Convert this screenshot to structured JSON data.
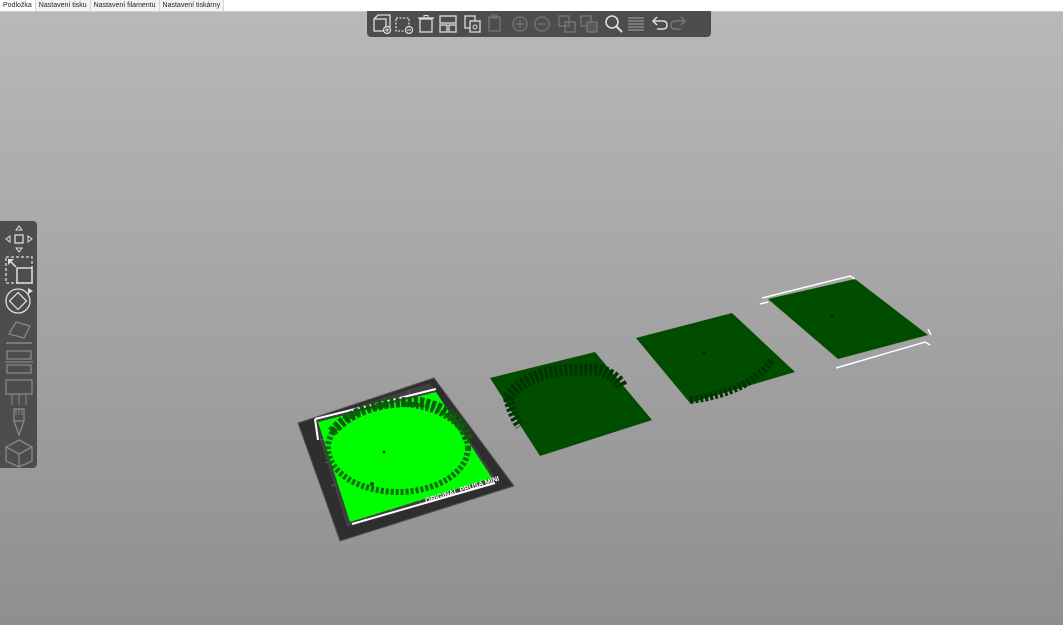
{
  "tabs": [
    {
      "label": "Podložka",
      "active": true
    },
    {
      "label": "Nastavení tisku",
      "active": false
    },
    {
      "label": "Nastavení filamentu",
      "active": false
    },
    {
      "label": "Nastavení tiskárny",
      "active": false
    }
  ],
  "toolbar": {
    "icons": [
      "add-icon",
      "delete-icon",
      "delete-all-icon",
      "arrange-icon",
      "copy-icon",
      "paste-icon",
      "add-instance-icon",
      "remove-instance-icon",
      "split-objects-icon",
      "split-parts-icon",
      "search-icon",
      "layers-icon",
      "undo-icon",
      "redo-icon"
    ]
  },
  "sidebar": {
    "icons": [
      "move-icon",
      "scale-icon",
      "rotate-icon",
      "place-on-face-icon",
      "cut-icon",
      "paint-supports-icon",
      "seam-paint-icon",
      "view-cube-icon"
    ]
  },
  "bed": {
    "label": "ORIGINAL PRUSA MINI",
    "accent_color": "#00ff00",
    "object_color_dark": "#004d00"
  }
}
